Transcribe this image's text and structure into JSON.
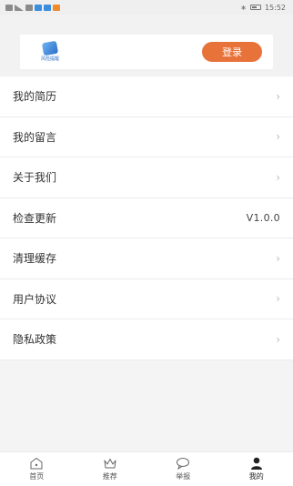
{
  "status_bar": {
    "time": "15:52",
    "bluetooth": "∗"
  },
  "header": {
    "logo_text": "风险提醒",
    "login_label": "登录"
  },
  "menu": [
    {
      "label": "我的简历"
    },
    {
      "label": "我的留言"
    },
    {
      "label": "关于我们"
    },
    {
      "label": "检查更新",
      "value": "V1.0.0"
    },
    {
      "label": "清理缓存"
    },
    {
      "label": "用户协议"
    },
    {
      "label": "隐私政策"
    }
  ],
  "chevron": "›",
  "tabs": [
    {
      "label": "首页",
      "icon": "home-icon"
    },
    {
      "label": "推荐",
      "icon": "crown-icon"
    },
    {
      "label": "举报",
      "icon": "chat-bubble-icon"
    },
    {
      "label": "我的",
      "icon": "user-icon"
    }
  ],
  "colors": {
    "accent": "#e8733a",
    "logo_blue": "#2a6fc7"
  }
}
